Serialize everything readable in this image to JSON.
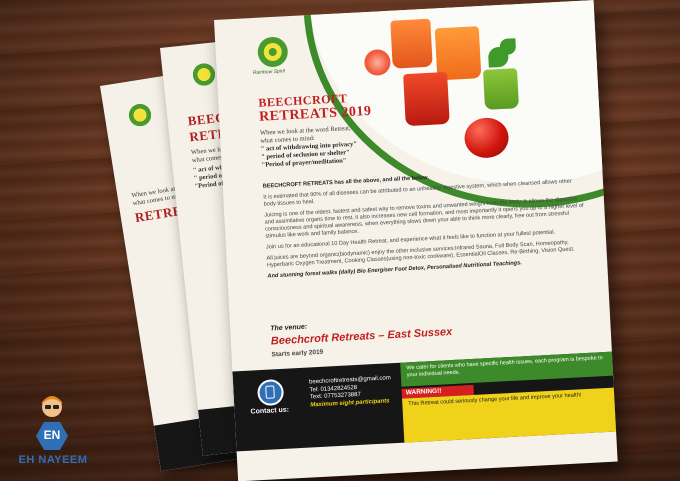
{
  "flyer": {
    "logo_caption": "Rainbow Spirit",
    "title_line1": "BEECHCROFT",
    "title_line2": "RETREATS 2019",
    "intro_line1": "When we look at the word Retreat,",
    "intro_line2": "what comes to mind:",
    "quotes": [
      "\" act of withdrawing into privacy\"",
      "\" period of seclusion or shelter\"",
      "\"Period of prayer/meditation\""
    ],
    "body_lead": "BEECHCROFT RETREATS has all the above, and all the below.",
    "body_paragraphs": [
      "It is estimated that 90% of all diseases can be attributed to an unhealthy digestive system, which when cleansed allows other body tissues to heal.",
      "Juicing is one of the oldest, fastest and safest way to remove toxins and unwanted weight from the body. It allows the digestive and assimilative organs time to rest, it also increases new cell formation, and most importantly it opens you up to a higher level of consciousness and spiritual awareness, when everything slows down your able to think more clearly, free out from stressful stimulus like work and family balance.",
      "Join us for an educational 10 Day Health Retreat, and experience what it feels like to function at your fullest potential.",
      "All juices are beyond organic(biodynamic) enjoy the other inclusive services:Infrared Sauna, Full Body Scan, Homeopathy, Hyperbaric Oxygen Treatment, Cooking Classes(using non-toxic cookware), EssentialOil Classes, Re-Birthing, Vision Quest."
    ],
    "body_closing": "And stunning forest walks (daily) Bio Energiser Foot Detox, Personalised Nutritional Teachings.",
    "venue_label": "The venue:",
    "venue_name": "Beechcroft Retreats – East Sussex",
    "starts": "Starts early 2019",
    "footer": {
      "contact_label": "Contact us:",
      "email": "beechcroftretreats@gmail.com",
      "tel": "Tel: 01342824528",
      "text": "Text: 07753273887",
      "max": "Maximum eight participants",
      "green_panel": "We cater for clients who have specific health issues, each program is bespoke to your individual needs.",
      "warning": "WARNING!!",
      "warning_text": "This Retreat could seriously change your life and improve your health!"
    }
  },
  "back_flyers": {
    "title_a": "BEECHCROFT",
    "title_b": "RETREATS",
    "lines": [
      "When we look at the word",
      "what comes to mind:",
      "\" act of withdrawing",
      "\" period of seclusion",
      "\"Period of prayer/m"
    ]
  },
  "badge": {
    "initials": "EN",
    "name": "EH NAYEEM"
  },
  "colors": {
    "accent_red": "#c0201f",
    "accent_green": "#3c8a2a",
    "accent_yellow": "#f1d21b",
    "badge_blue": "#2f6fb6"
  }
}
